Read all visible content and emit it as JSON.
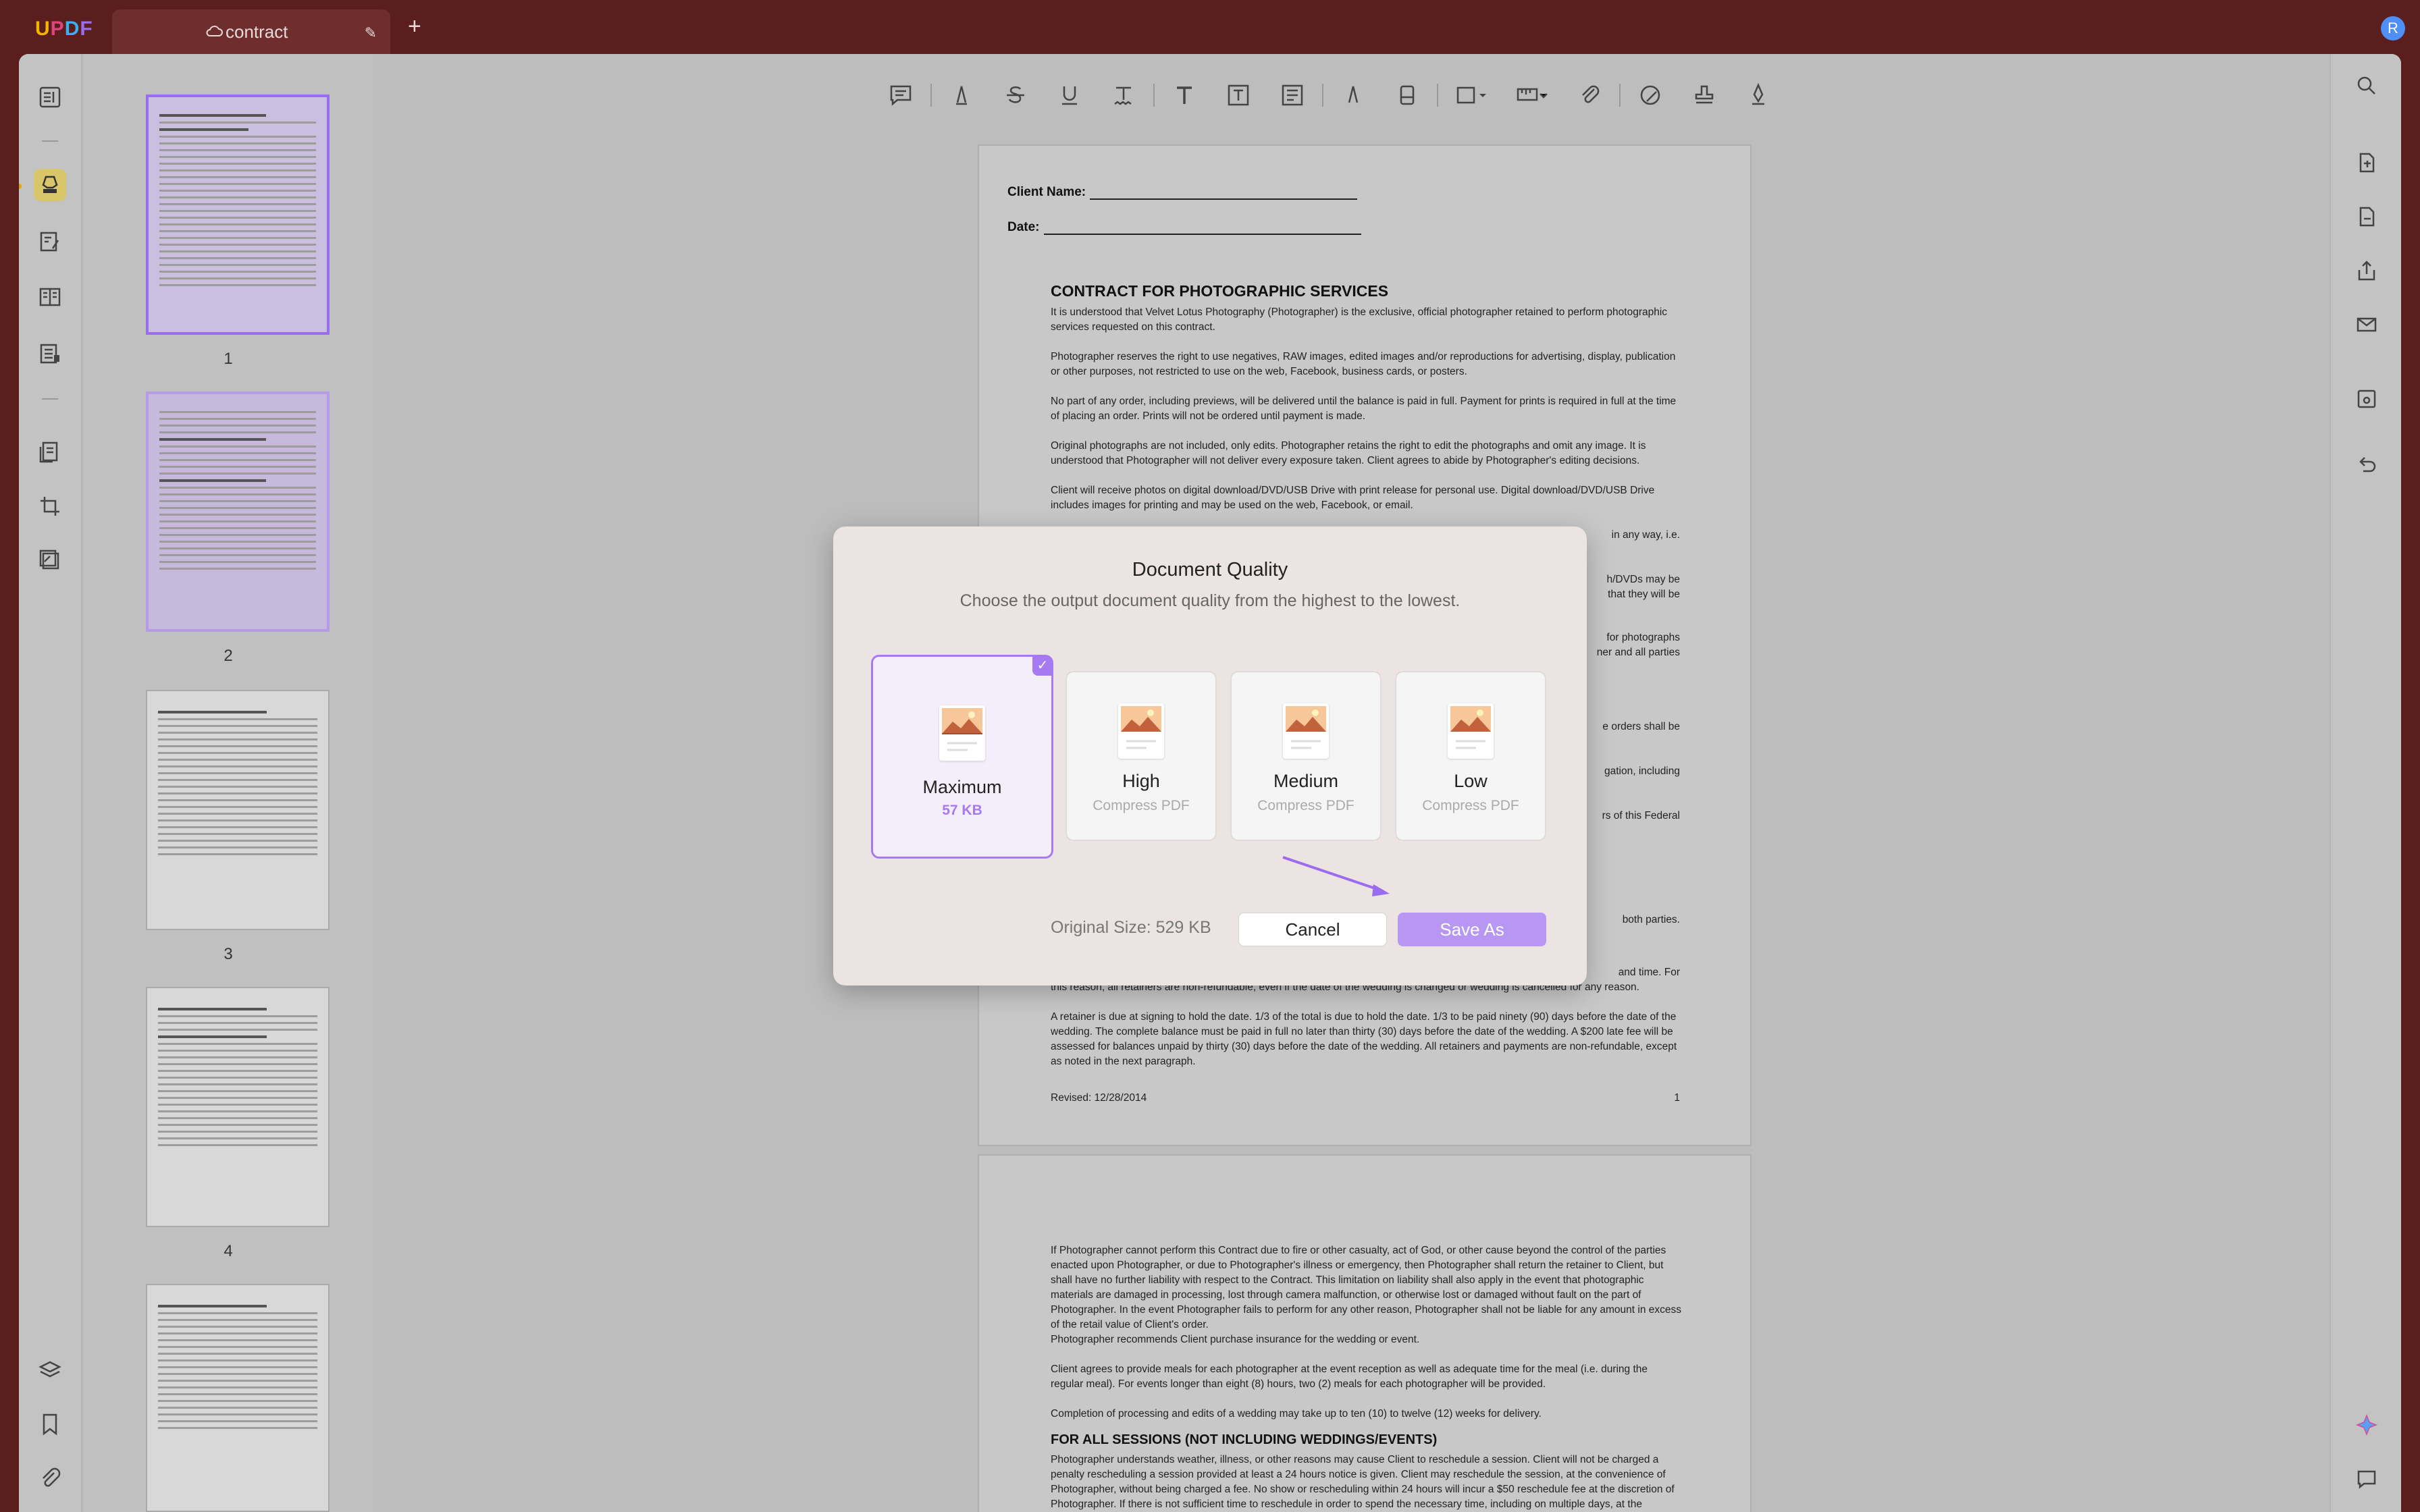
{
  "app": {
    "logo": [
      "U",
      "P",
      "D",
      "F"
    ],
    "avatar_initial": "R"
  },
  "tab": {
    "title": "contract"
  },
  "thumbnails": {
    "pages": [
      "1",
      "2",
      "3",
      "4"
    ]
  },
  "document": {
    "client_name_label": "Client Name:",
    "date_label": "Date:",
    "heading": "CONTRACT FOR PHOTOGRAPHIC SERVICES",
    "paragraphs": [
      "It is understood that Velvet Lotus Photography (Photographer) is the exclusive, official photographer retained to perform photographic services requested on this contract.",
      "Photographer reserves the right to use negatives, RAW images, edited images and/or reproductions for advertising, display, publication or other purposes, not restricted to use on the web, Facebook, business cards, or posters.",
      "No part of any order, including previews, will be delivered until the balance is paid in full. Payment for prints is required in full at the time of placing an order. Prints will not be ordered until payment is made.",
      "Original photographs are not included, only edits. Photographer retains the right to edit the photographs and omit any image. It is understood that Photographer will not deliver every exposure taken. Client agrees to abide by Photographer's editing decisions.",
      "Client will receive photos on digital download/DVD/USB Drive with print release for personal use. Digital download/DVD/USB Drive includes images for printing and may be used on the web, Facebook, or email."
    ],
    "right_fragments": [
      "in any way, i.e.",
      "h/DVDs may be",
      "that they will be",
      "for photographs",
      "ner and all parties",
      "e orders shall be",
      "gation, including",
      "rs of this Federal",
      "both parties."
    ],
    "lower_paragraphs": [
      "this reason, all retainers are non-refundable, even if the date of the wedding is changed or wedding is cancelled for any reason.",
      "A retainer is due at signing to hold the date. 1/3 of the total is due to hold the date. 1/3 to be paid ninety (90) days before the date of the wedding. The complete balance must be paid in full no later than thirty (30) days before the date of the wedding. A $200 late fee will be assessed for balances unpaid by thirty (30) days before the date of the wedding. All retainers and payments are non-refundable, except as noted in the next paragraph."
    ],
    "lower_fragment_right": "and time. For",
    "revised": "Revised: 12/28/2014",
    "page_number": "1",
    "page2_paragraphs": [
      "If Photographer cannot perform this Contract due to fire or other casualty, act of God, or other cause beyond the control of the parties enacted upon Photographer, or due to Photographer's illness or emergency, then Photographer shall return the retainer to Client, but shall have no further liability with respect to the Contract. This limitation on liability shall also apply in the event that photographic materials are damaged in processing, lost through camera malfunction, or otherwise lost or damaged without fault on the part of Photographer. In the event Photographer fails to perform for any other reason, Photographer shall not be liable for any amount in excess of the retail value of Client's order.",
      "Photographer recommends Client purchase insurance for the wedding or event.",
      "Client agrees to provide meals for each photographer at the event reception as well as adequate time for the meal (i.e. during the regular meal). For events longer than eight (8) hours, two (2) meals for each photographer will be provided.",
      "Completion of processing and edits of a wedding may take up to ten (10) to twelve (12) weeks for delivery."
    ],
    "page2_heading": "FOR ALL SESSIONS (NOT INCLUDING WEDDINGS/EVENTS)",
    "page2_last": "Photographer understands weather, illness, or other reasons may cause Client to reschedule a session. Client will not be charged a penalty rescheduling a session provided at least a 24 hours notice is given. Client may reschedule the session, at the convenience of Photographer, without being charged a fee. No show or rescheduling within 24 hours will incur a $50 reschedule fee at the discretion of Photographer. If there is not sufficient time to reschedule in order to spend the necessary time, including on multiple days, at the convenience of Photographer, Photographer"
  },
  "dialog": {
    "title": "Document Quality",
    "subtitle": "Choose the output document quality from the highest to the lowest.",
    "options": [
      {
        "name": "Maximum",
        "sub": "57 KB"
      },
      {
        "name": "High",
        "sub": "Compress PDF"
      },
      {
        "name": "Medium",
        "sub": "Compress PDF"
      },
      {
        "name": "Low",
        "sub": "Compress PDF"
      }
    ],
    "original_size": "Original Size: 529 KB",
    "cancel": "Cancel",
    "save_as": "Save As",
    "accent": "#a77af2"
  },
  "colors": {
    "titlebar": "#5a1e1e",
    "accent": "#9a6cf0",
    "highlight_tool": "#d9c66a"
  }
}
